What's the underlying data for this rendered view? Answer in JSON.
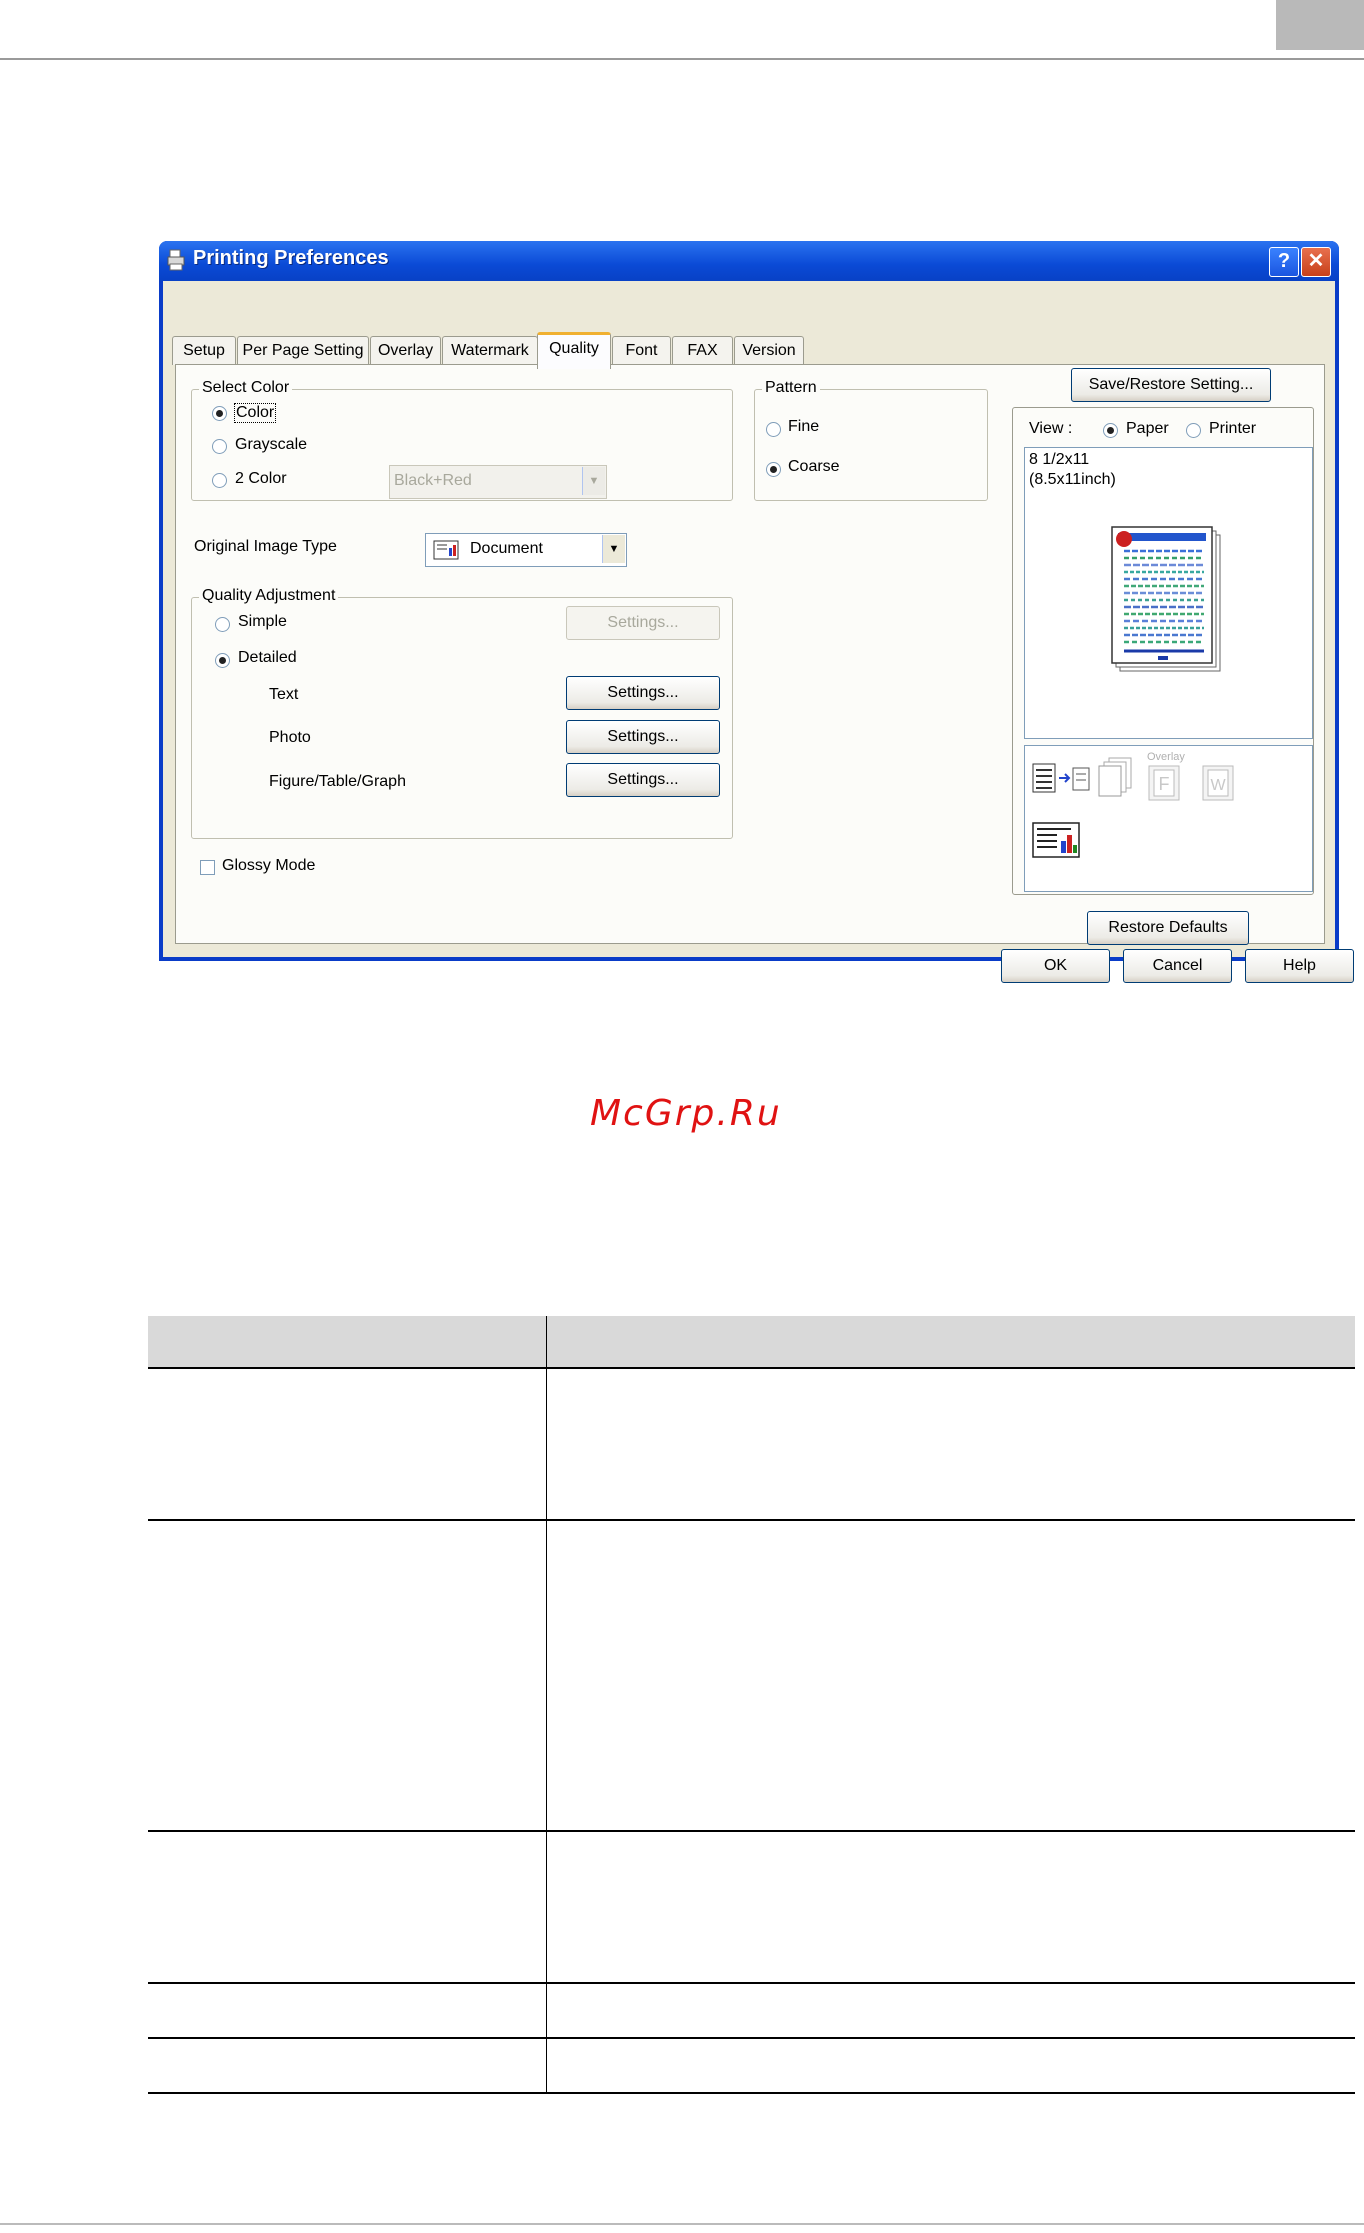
{
  "dialog": {
    "title": "Printing Preferences",
    "help_btn": "?",
    "close_btn": "✕",
    "tabs": [
      "Setup",
      "Per Page Setting",
      "Overlay",
      "Watermark",
      "Quality",
      "Font",
      "FAX",
      "Version"
    ],
    "active_tab": "Quality",
    "select_color": {
      "label": "Select Color",
      "options": [
        "Color",
        "Grayscale",
        "2 Color"
      ],
      "selected": "Color",
      "two_color_value": "Black+Red"
    },
    "pattern": {
      "label": "Pattern",
      "options": [
        "Fine",
        "Coarse"
      ],
      "selected": "Coarse"
    },
    "original_image_type": {
      "label": "Original Image Type",
      "value": "Document"
    },
    "quality_adjustment": {
      "label": "Quality Adjustment",
      "options": [
        "Simple",
        "Detailed"
      ],
      "selected": "Detailed",
      "simple_settings": "Settings...",
      "rows": [
        {
          "label": "Text",
          "button": "Settings..."
        },
        {
          "label": "Photo",
          "button": "Settings..."
        },
        {
          "label": "Figure/Table/Graph",
          "button": "Settings..."
        }
      ]
    },
    "glossy_mode": {
      "label": "Glossy Mode",
      "checked": false
    },
    "save_restore": "Save/Restore Setting...",
    "view": {
      "label": "View :",
      "options": [
        "Paper",
        "Printer"
      ],
      "selected": "Paper"
    },
    "paper_size": {
      "line1": "8 1/2x11",
      "line2": "(8.5x11inch)"
    },
    "overlay_caption": "Overlay",
    "restore_defaults": "Restore Defaults",
    "footer_buttons": {
      "ok": "OK",
      "cancel": "Cancel",
      "help": "Help"
    }
  },
  "watermark": "McGrp.Ru",
  "colors": {
    "title_bar": "#0a4ad6",
    "face": "#ece9d8",
    "watermark": "#e01212"
  }
}
